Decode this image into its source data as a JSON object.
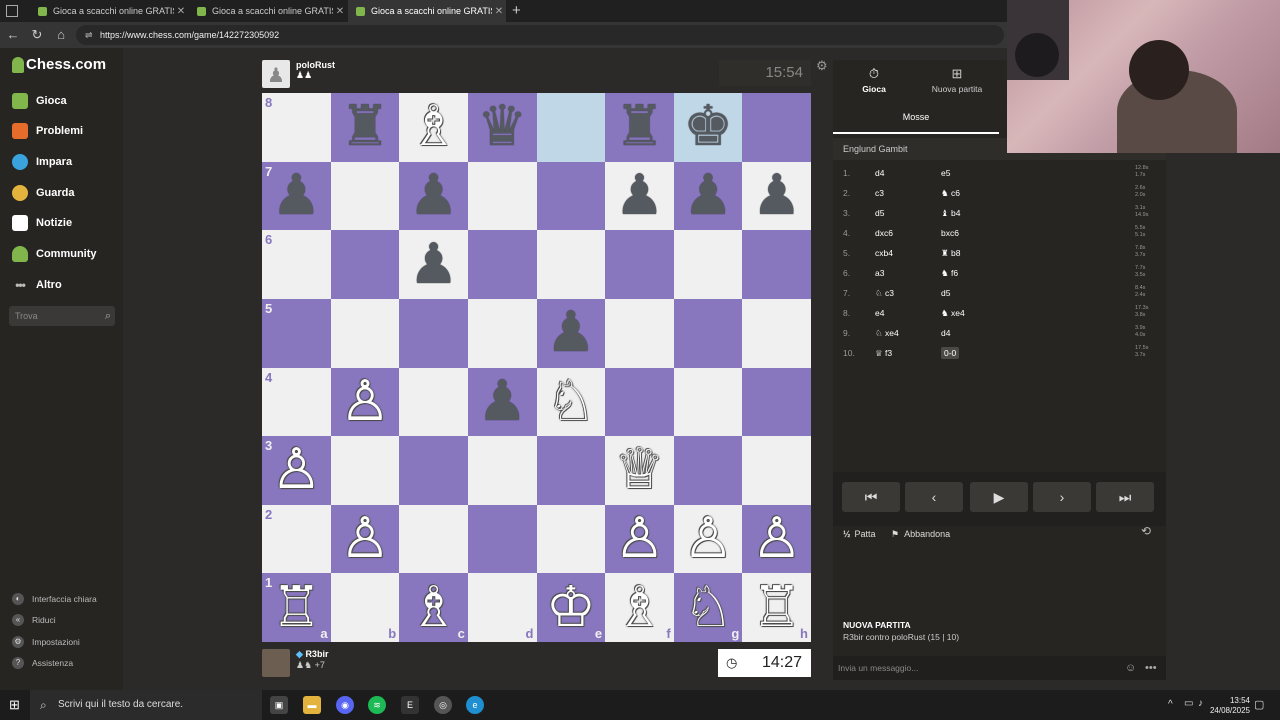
{
  "browser": {
    "tabs": [
      {
        "title": "Gioca a scacchi online GRATIS - S",
        "active": false
      },
      {
        "title": "Gioca a scacchi online GRATIS - S",
        "active": false
      },
      {
        "title": "Gioca a scacchi online GRATIS - S",
        "active": true
      }
    ],
    "new_tab_icon": "+",
    "url": "https://www.chess.com/game/142272305092"
  },
  "sidebar": {
    "logo": "Chess.com",
    "items": [
      {
        "label": "Gioca",
        "icon": "play-board-icon",
        "color": "#81b64c"
      },
      {
        "label": "Problemi",
        "icon": "puzzle-icon",
        "color": "#e66c2c"
      },
      {
        "label": "Impara",
        "icon": "learn-icon",
        "color": "#3aa3dd"
      },
      {
        "label": "Guarda",
        "icon": "watch-icon",
        "color": "#e3b33e"
      },
      {
        "label": "Notizie",
        "icon": "news-icon",
        "color": "#ffffff"
      },
      {
        "label": "Community",
        "icon": "community-icon",
        "color": "#81b64c"
      },
      {
        "label": "Altro",
        "icon": "more-icon",
        "color": "#bbbbbb"
      }
    ],
    "search_placeholder": "Trova",
    "bottom": [
      {
        "label": "Interfaccia chiara",
        "icon": "theme-icon"
      },
      {
        "label": "Riduci",
        "icon": "collapse-icon"
      },
      {
        "label": "Impostazioni",
        "icon": "settings-icon"
      },
      {
        "label": "Assistenza",
        "icon": "help-icon"
      }
    ]
  },
  "game": {
    "top_player": {
      "name": "poloRust",
      "clock": "15:54"
    },
    "bottom_player": {
      "name": "R3bir",
      "clock": "14:27",
      "captured_bonus": "+7"
    },
    "board": {
      "ranks": [
        "8",
        "7",
        "6",
        "5",
        "4",
        "3",
        "2",
        "1"
      ],
      "files": [
        "a",
        "b",
        "c",
        "d",
        "e",
        "f",
        "g",
        "h"
      ],
      "rows": [
        [
          "",
          "bR",
          "wB",
          "bQ",
          "",
          "bR",
          "bK",
          ""
        ],
        [
          "bP",
          "",
          "bP",
          "",
          "",
          "bP",
          "bP",
          "bP"
        ],
        [
          "",
          "",
          "bP",
          "",
          "",
          "",
          "",
          ""
        ],
        [
          "",
          "",
          "",
          "",
          "bP",
          "",
          "",
          ""
        ],
        [
          "",
          "wP",
          "",
          "bP",
          "wN",
          "",
          "",
          ""
        ],
        [
          "wP",
          "",
          "",
          "",
          "",
          "wQ",
          "",
          ""
        ],
        [
          "",
          "wP",
          "",
          "",
          "",
          "wP",
          "wP",
          "wP"
        ],
        [
          "wR",
          "",
          "wB",
          "",
          "wK",
          "wB",
          "wN",
          "wR"
        ]
      ],
      "highlight": [
        "e8",
        "g8"
      ]
    }
  },
  "panel": {
    "tab_play": "Gioca",
    "tab_new": "Nuova partita",
    "tab_moves": "Mosse",
    "opening": "Englund Gambit",
    "moves": [
      {
        "n": "1.",
        "w": "d4",
        "b": "e5",
        "tw": "12.8s",
        "tb": "1.7s"
      },
      {
        "n": "2.",
        "w": "c3",
        "b": "♞ c6",
        "tw": "2.6s",
        "tb": "2.0s"
      },
      {
        "n": "3.",
        "w": "d5",
        "b": "♝ b4",
        "tw": "3.1s",
        "tb": "14.9s"
      },
      {
        "n": "4.",
        "w": "dxc6",
        "b": "bxc6",
        "tw": "5.5s",
        "tb": "5.1s"
      },
      {
        "n": "5.",
        "w": "cxb4",
        "b": "♜ b8",
        "tw": "7.8s",
        "tb": "3.7s"
      },
      {
        "n": "6.",
        "w": "a3",
        "b": "♞ f6",
        "tw": "7.7s",
        "tb": "3.5s"
      },
      {
        "n": "7.",
        "w": "♘ c3",
        "b": "d5",
        "tw": "8.4s",
        "tb": "2.4s"
      },
      {
        "n": "8.",
        "w": "e4",
        "b": "♞ xe4",
        "tw": "17.3s",
        "tb": "3.8s"
      },
      {
        "n": "9.",
        "w": "♘ xe4",
        "b": "d4",
        "tw": "3.9s",
        "tb": "4.0s"
      },
      {
        "n": "10.",
        "w": "♕ f3",
        "b": "0-0",
        "tw": "17.5s",
        "tb": "3.7s"
      }
    ],
    "draw": "Patta",
    "resign": "Abbandona",
    "new_game_title": "NUOVA PARTITA",
    "new_game_detail": "R3bir contro poloRust (15 | 10)",
    "chat_placeholder": "Invia un messaggio..."
  },
  "taskbar": {
    "search_placeholder": "Scrivi qui il testo da cercare.",
    "time": "13:54",
    "date": "24/08/2025"
  }
}
